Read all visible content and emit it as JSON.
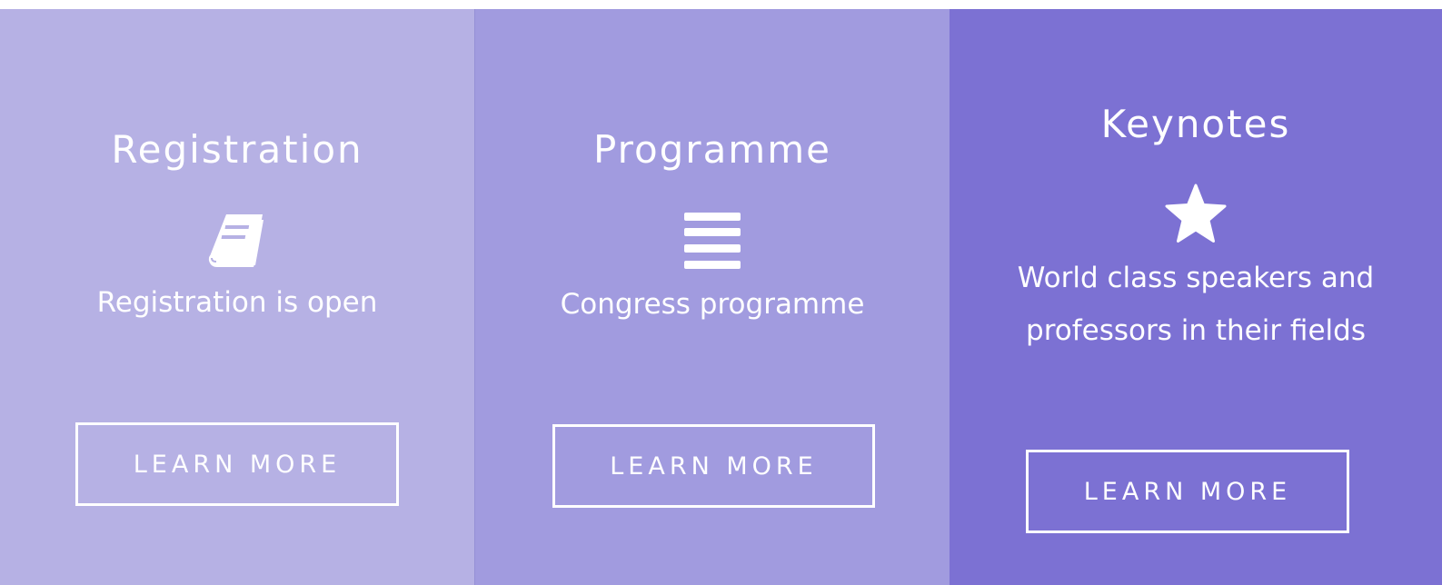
{
  "panels": [
    {
      "title": "Registration",
      "icon": "book-icon",
      "description": "Registration is open",
      "button_label": "LEARN MORE",
      "background": "#b6b1e4"
    },
    {
      "title": "Programme",
      "icon": "list-icon",
      "description": "Congress programme",
      "button_label": "LEARN MORE",
      "background": "#a19bdf"
    },
    {
      "title": "Keynotes",
      "icon": "star-icon",
      "description_line1": "World class speakers and",
      "description_line2": "professors in their fields",
      "button_label": "LEARN MORE",
      "background": "#7c71d3"
    }
  ]
}
